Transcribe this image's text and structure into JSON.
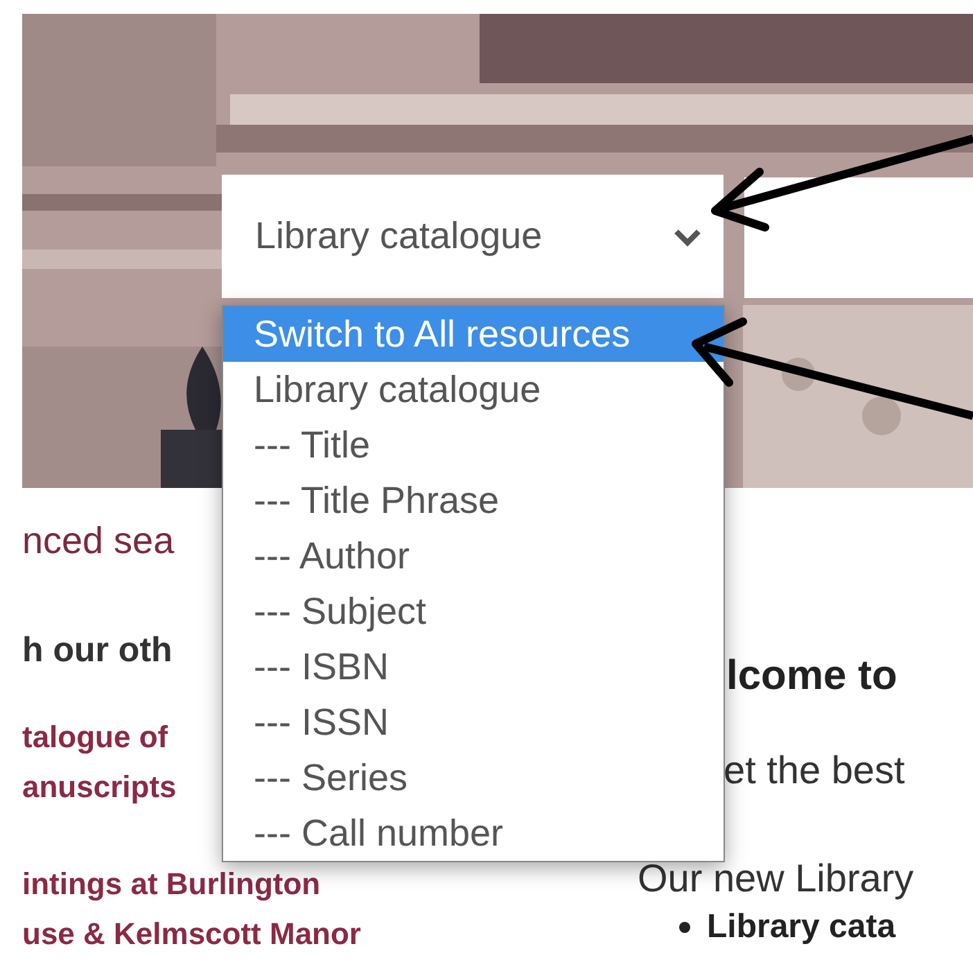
{
  "select": {
    "value": "Library catalogue",
    "expanded": true
  },
  "dropdown_options": [
    {
      "label": "Switch to All resources",
      "selected": true
    },
    {
      "label": "Library catalogue",
      "selected": false
    },
    {
      "label": "--- Title",
      "selected": false
    },
    {
      "label": "--- Title Phrase",
      "selected": false
    },
    {
      "label": "--- Author",
      "selected": false
    },
    {
      "label": "--- Subject",
      "selected": false
    },
    {
      "label": "--- ISBN",
      "selected": false
    },
    {
      "label": "--- ISSN",
      "selected": false
    },
    {
      "label": "--- Series",
      "selected": false
    },
    {
      "label": "--- Call number",
      "selected": false
    }
  ],
  "sidebar": {
    "advanced_search_link": "nced sea",
    "heading": "h our oth",
    "links": [
      "talogue of",
      "anuscripts",
      "intings at Burlington",
      "use & Kelmscott Manor"
    ]
  },
  "main": {
    "heading": "lcome to",
    "intro": "et the best",
    "paragraph": "Our new Library",
    "list_item": "Library cata"
  }
}
